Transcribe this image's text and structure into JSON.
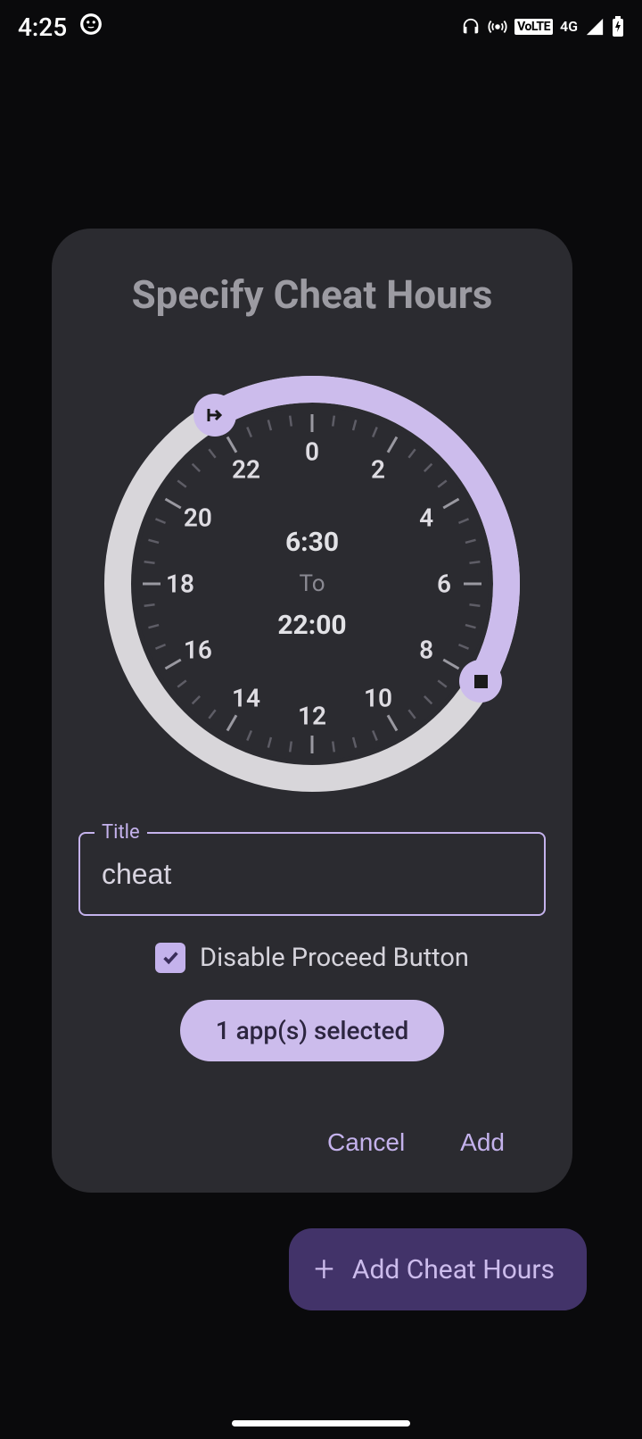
{
  "status": {
    "time": "4:25",
    "network_badge": "VoLTE",
    "network_gen": "4G"
  },
  "dialog": {
    "title": "Specify Cheat Hours",
    "clock": {
      "start": "6:30",
      "to_label": "To",
      "end": "22:00",
      "labels": [
        "0",
        "2",
        "4",
        "6",
        "8",
        "10",
        "12",
        "14",
        "16",
        "18",
        "20",
        "22"
      ]
    },
    "title_field": {
      "label": "Title",
      "value": "cheat"
    },
    "checkbox": {
      "label": "Disable Proceed Button",
      "checked": true
    },
    "chip": "1 app(s) selected",
    "cancel": "Cancel",
    "add": "Add"
  },
  "fab": {
    "label": "Add Cheat Hours"
  }
}
